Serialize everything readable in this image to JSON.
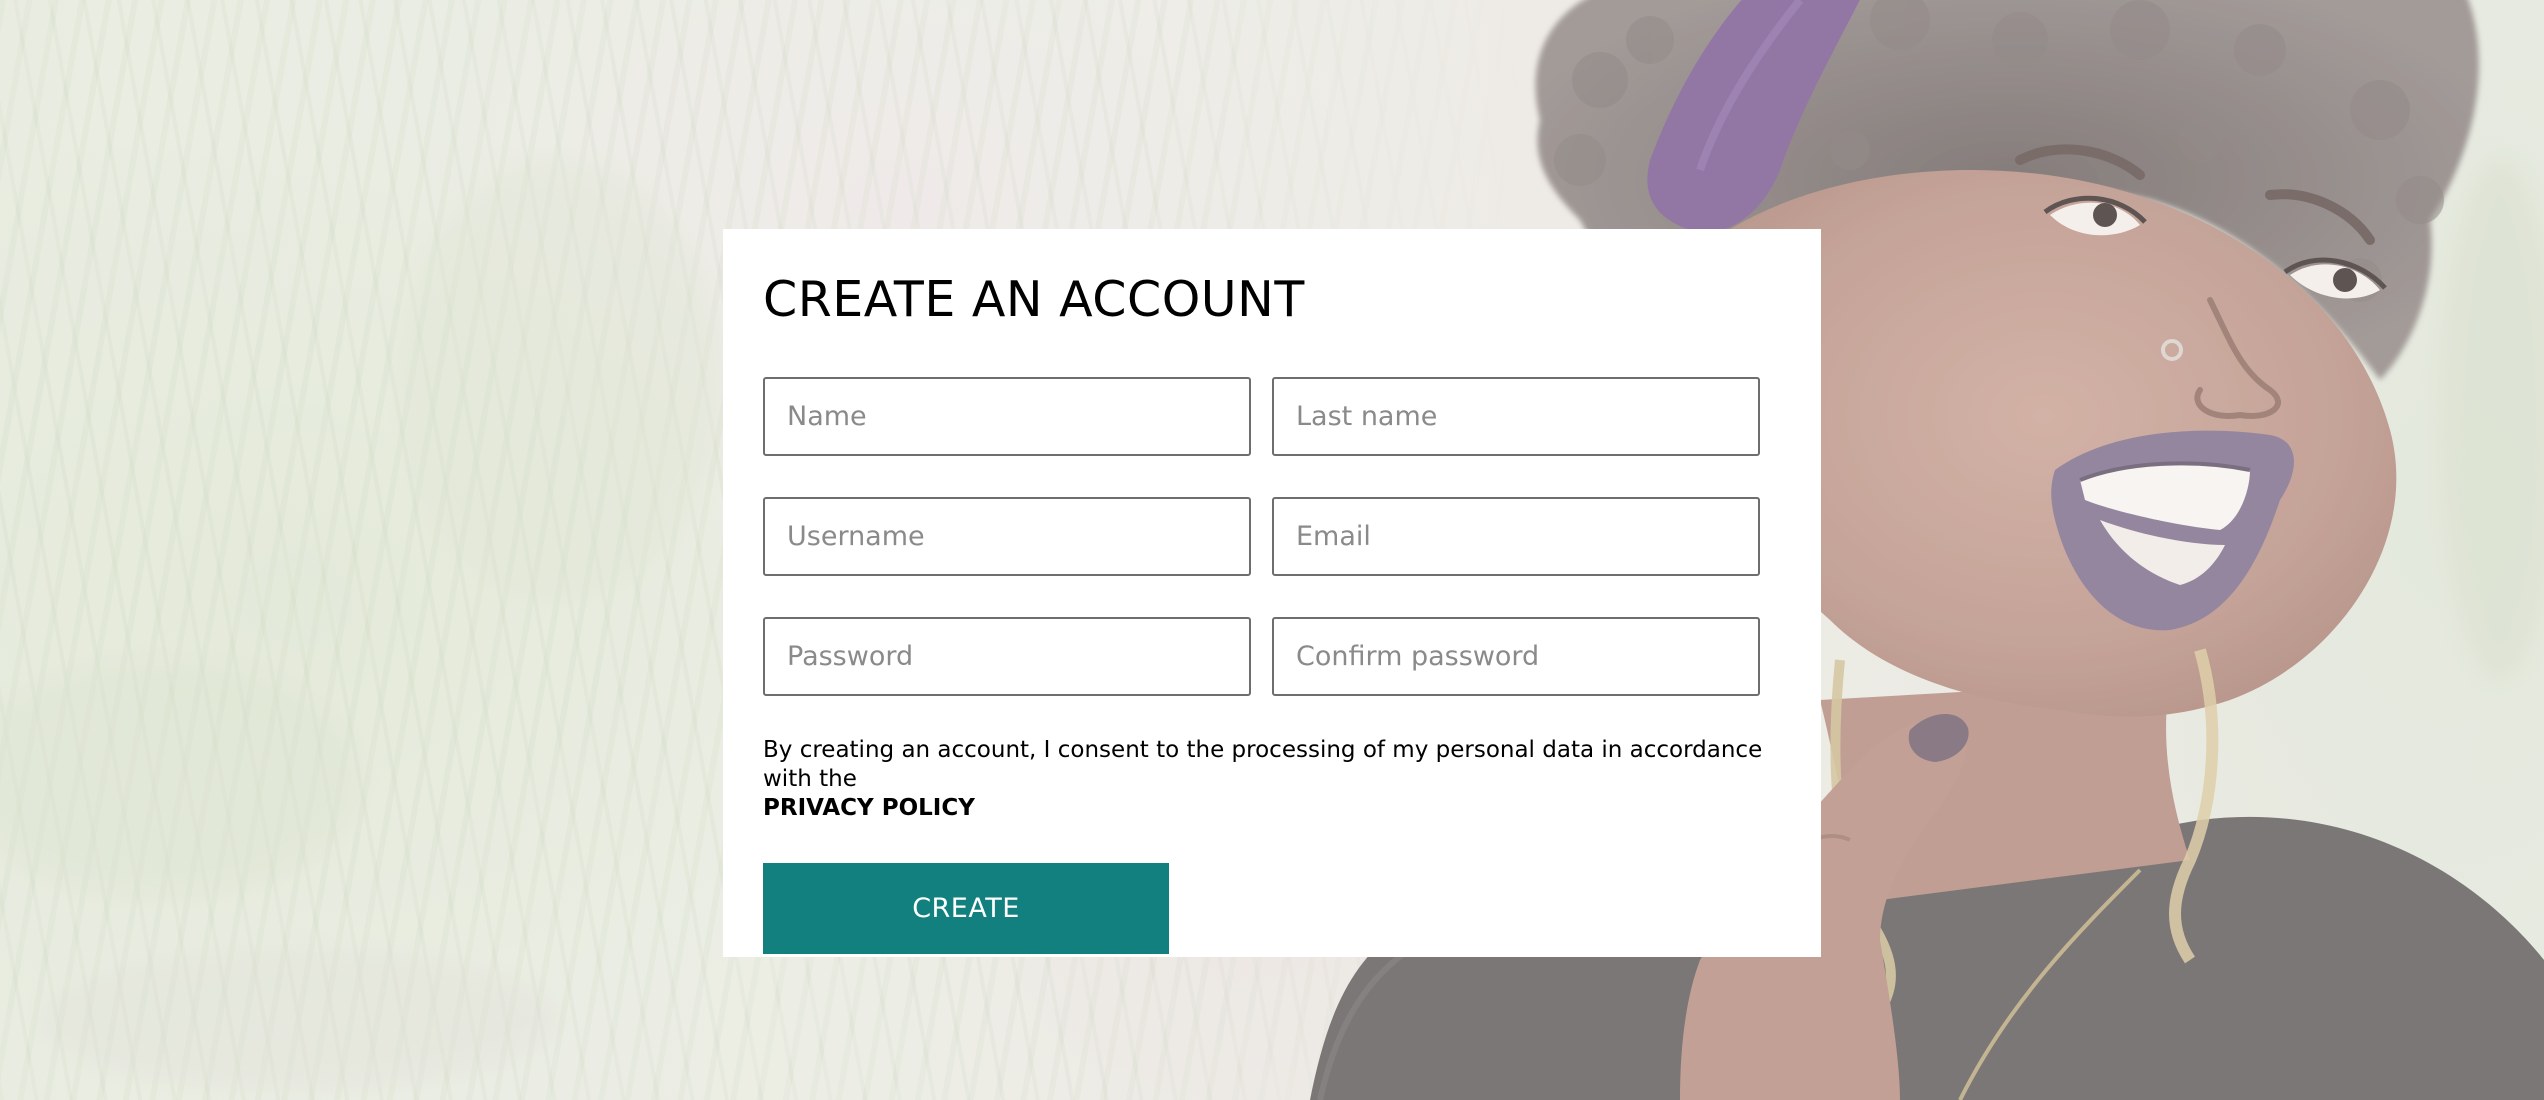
{
  "form": {
    "title": "CREATE AN ACCOUNT",
    "fields": {
      "name_placeholder": "Name",
      "last_name_placeholder": "Last name",
      "username_placeholder": "Username",
      "email_placeholder": "Email",
      "password_placeholder": "Password",
      "confirm_password_placeholder": "Confirm password"
    },
    "consent_text": "By creating an account, I consent to the processing of my personal data in accordance with the",
    "privacy_link": "PRIVACY POLICY",
    "submit_label": "CREATE"
  },
  "colors": {
    "accent": "#11807e",
    "card_background": "#ffffff",
    "field_border": "#6e6e6e",
    "placeholder": "#8a8a8a"
  }
}
